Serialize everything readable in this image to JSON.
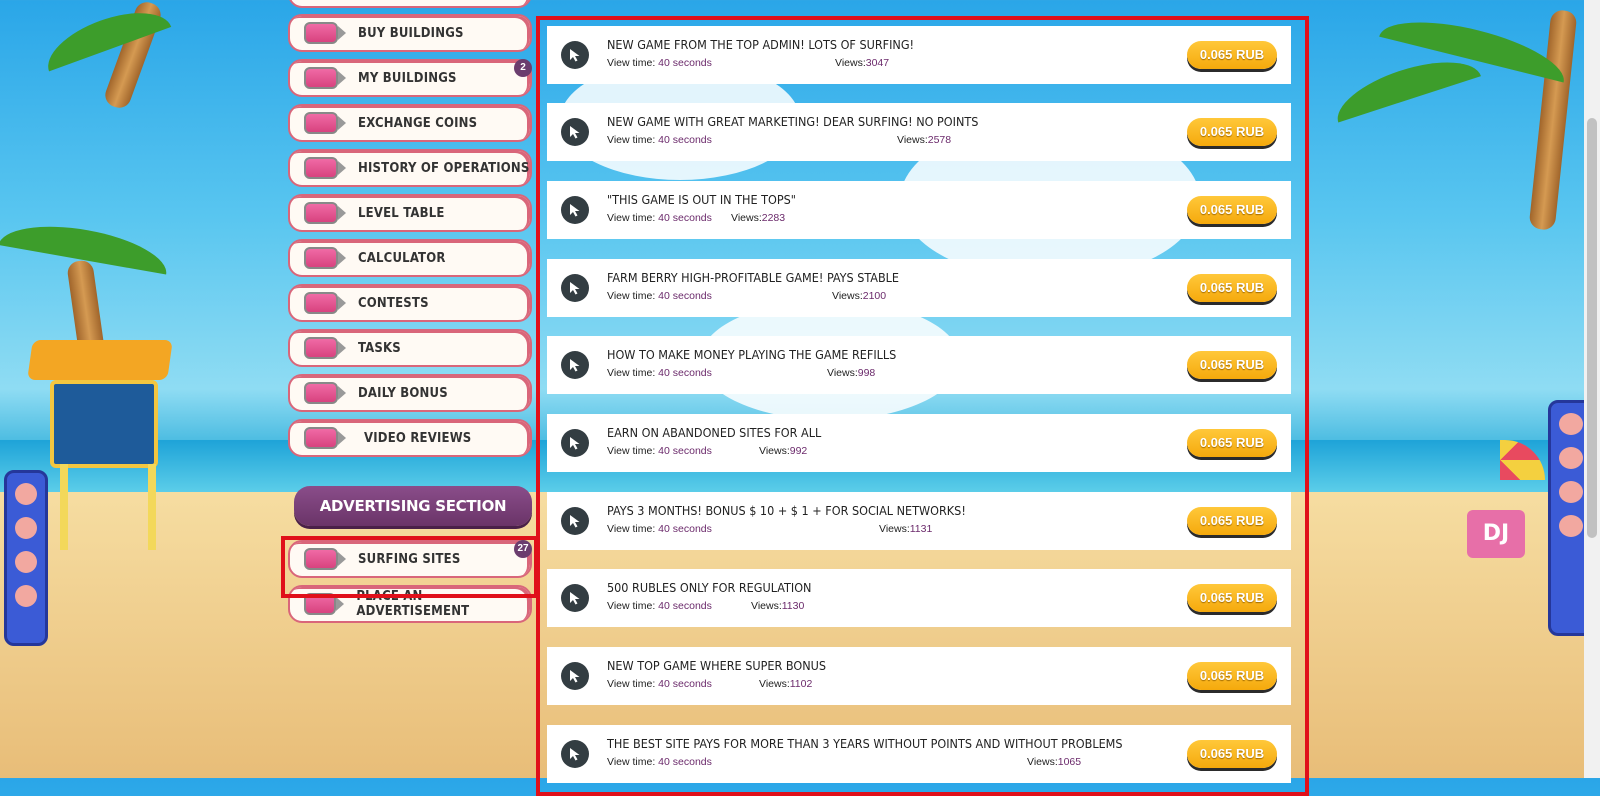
{
  "sidebar": {
    "items": [
      {
        "label": "BUY BUILDINGS"
      },
      {
        "label": "MY BUILDINGS",
        "badge": "2"
      },
      {
        "label": "EXCHANGE COINS"
      },
      {
        "label": "HISTORY OF OPERATIONS"
      },
      {
        "label": "LEVEL TABLE"
      },
      {
        "label": "CALCULATOR"
      },
      {
        "label": "CONTESTS"
      },
      {
        "label": "TASKS"
      },
      {
        "label": "DAILY BONUS"
      },
      {
        "label": "VIDEO REVIEWS"
      }
    ],
    "ad_section_title": "ADVERTISING SECTION",
    "ad_items": [
      {
        "label": "SURFING SITES",
        "badge": "27"
      },
      {
        "label": "PLACE AN ADVERTISEMENT"
      }
    ]
  },
  "surf_list": {
    "view_time_label": "View time:",
    "views_label": "Views:",
    "rows": [
      {
        "title": "NEW GAME FROM THE TOP ADMIN! LOTS OF SURFING!",
        "view_time": "40 seconds",
        "views": "3047",
        "price": "0.065 RUB"
      },
      {
        "title": "NEW GAME WITH GREAT MARKETING! DEAR SURFING! NO POINTS",
        "view_time": "40 seconds",
        "views": "2578",
        "price": "0.065 RUB"
      },
      {
        "title": "\"THIS GAME IS OUT IN THE TOPS\"",
        "view_time": "40 seconds",
        "views": "2283",
        "price": "0.065 RUB"
      },
      {
        "title": "FARM BERRY HIGH-PROFITABLE GAME! PAYS STABLE",
        "view_time": "40 seconds",
        "views": "2100",
        "price": "0.065 RUB"
      },
      {
        "title": "HOW TO MAKE MONEY PLAYING THE GAME REFILLS",
        "view_time": "40 seconds",
        "views": "998",
        "price": "0.065 RUB"
      },
      {
        "title": "EARN ON ABANDONED SITES FOR ALL",
        "view_time": "40 seconds",
        "views": "992",
        "price": "0.065 RUB"
      },
      {
        "title": "PAYS 3 MONTHS! BONUS $ 10 + $ 1 + FOR SOCIAL NETWORKS!",
        "view_time": "40 seconds",
        "views": "1131",
        "price": "0.065 RUB"
      },
      {
        "title": "500 RUBLES ONLY FOR REGULATION",
        "view_time": "40 seconds",
        "views": "1130",
        "price": "0.065 RUB"
      },
      {
        "title": "NEW TOP GAME WHERE SUPER BONUS",
        "view_time": "40 seconds",
        "views": "1102",
        "price": "0.065 RUB"
      },
      {
        "title": "THE BEST SITE PAYS FOR MORE THAN 3 YEARS WITHOUT POINTS AND WITHOUT PROBLEMS",
        "view_time": "40 seconds",
        "views": "1065",
        "price": "0.065 RUB"
      }
    ]
  },
  "colors": {
    "accent_red": "#e0101a",
    "price_gold": "#f5a90c",
    "ad_purple": "#6a3468",
    "menu_border": "#d9667a"
  },
  "icons": {
    "menu_item": "pink-pill-icon",
    "row": "cursor-icon"
  }
}
